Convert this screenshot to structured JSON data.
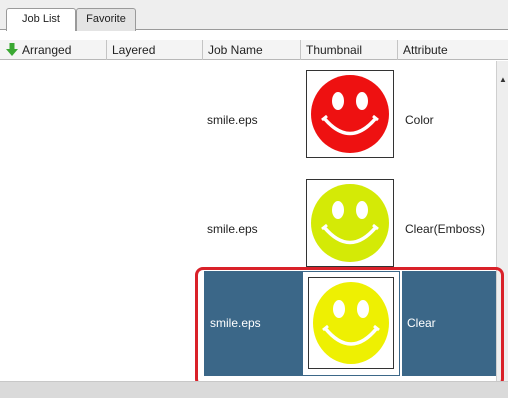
{
  "tabs": [
    {
      "label": "Job List",
      "active": true
    },
    {
      "label": "Favorite",
      "active": false
    }
  ],
  "columns": [
    "Arranged",
    "Layered",
    "Job Name",
    "Thumbnail",
    "Attribute"
  ],
  "sort_icon": "green-down-arrow-icon",
  "rows": [
    {
      "job_name": "smile.eps",
      "thumbnail": "red-smiley",
      "thumbnail_color": "#ee1111",
      "attribute": "Color",
      "selected": false
    },
    {
      "job_name": "smile.eps",
      "thumbnail": "yellow-green-smiley",
      "thumbnail_color": "#d4ea06",
      "attribute": "Clear(Emboss)",
      "selected": false
    },
    {
      "job_name": "smile.eps",
      "thumbnail": "yellow-smiley",
      "thumbnail_color": "#eef002",
      "attribute": "Clear",
      "selected": true
    }
  ],
  "colors": {
    "selection": "#3b6788",
    "highlight_outline": "#d92129"
  }
}
